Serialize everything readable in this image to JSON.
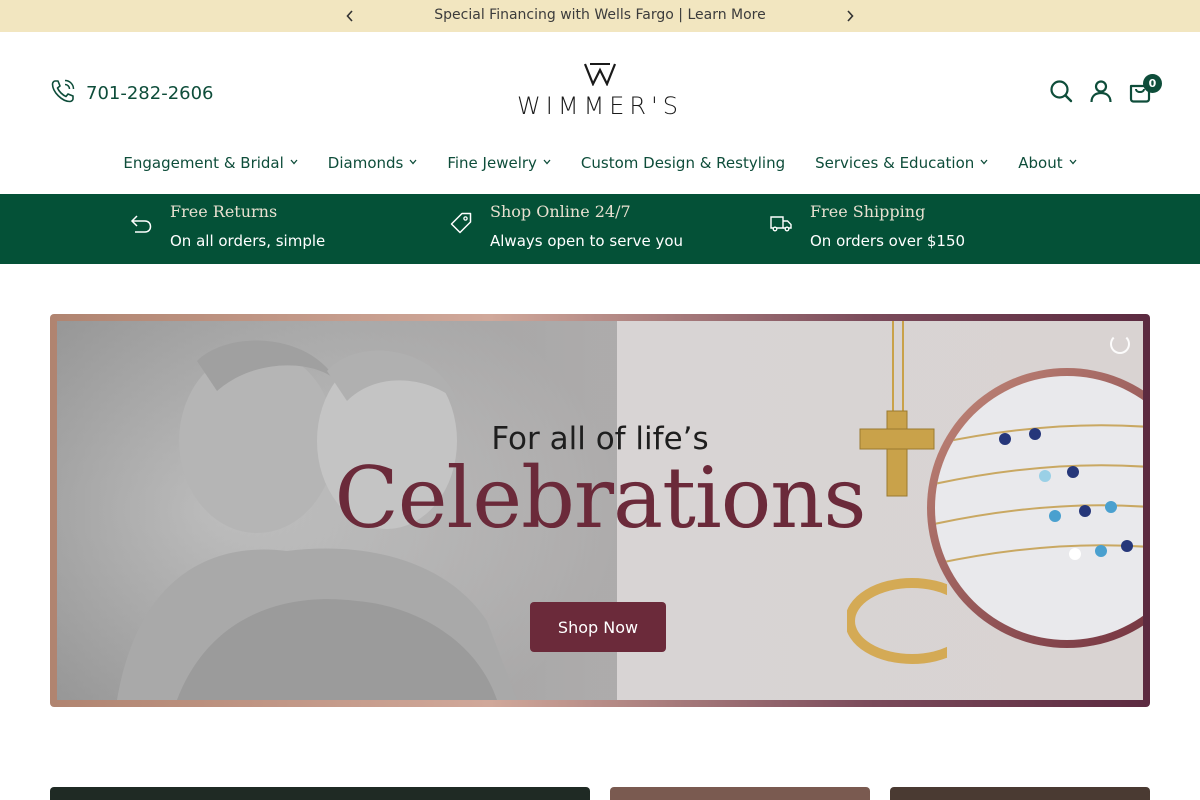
{
  "announcement": {
    "text": "Special Financing with Wells Fargo | Learn More",
    "prev_icon": "chevron-left-icon",
    "next_icon": "chevron-right-icon"
  },
  "header": {
    "phone": "701-282-2606",
    "phone_icon": "phone-icon",
    "logo_text": "WIMMER'S",
    "search_icon": "search-icon",
    "account_icon": "user-icon",
    "cart_icon": "bag-icon",
    "cart_count": "0"
  },
  "nav": {
    "items": [
      {
        "label": "Engagement & Bridal",
        "has_menu": true
      },
      {
        "label": "Diamonds",
        "has_menu": true
      },
      {
        "label": "Fine Jewelry",
        "has_menu": true
      },
      {
        "label": "Custom Design & Restyling",
        "has_menu": false
      },
      {
        "label": "Services & Education",
        "has_menu": true
      },
      {
        "label": "About",
        "has_menu": true
      }
    ]
  },
  "benefits": [
    {
      "title": "Free Returns",
      "sub": "On all orders, simple",
      "icon": "return-arrow-icon"
    },
    {
      "title": "Shop Online 24/7",
      "sub": "Always open to serve you",
      "icon": "tag-icon"
    },
    {
      "title": "Free Shipping",
      "sub": "On orders over $150",
      "icon": "truck-icon"
    }
  ],
  "hero": {
    "line1": "For all of life’s",
    "line2": "Celebrations",
    "cta": "Shop Now"
  },
  "colors": {
    "brand_green": "#045137",
    "announce_bg": "#f2e6c0",
    "hero_accent": "#6b2a3a"
  }
}
